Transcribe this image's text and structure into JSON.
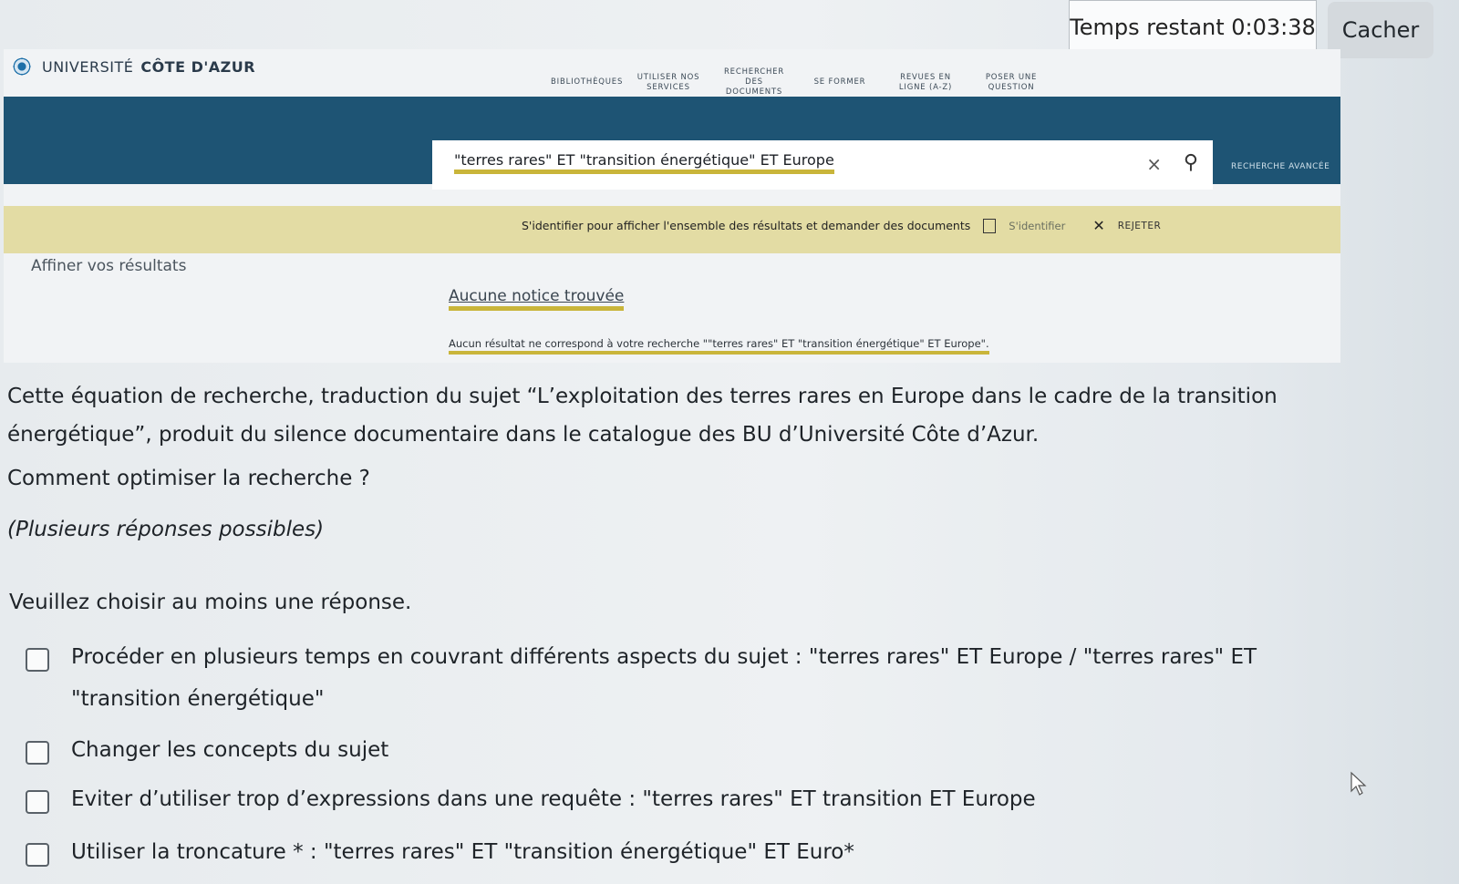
{
  "timer": {
    "label": "Temps restant 0:03:38",
    "hide_label": "Cacher"
  },
  "portal": {
    "brand_prefix": "UNIVERSITÉ",
    "brand_name": "CÔTE D'AZUR",
    "nav": [
      "BIBLIOTHÈQUES",
      "UTILISER NOS SERVICES",
      "RECHERCHER DES DOCUMENTS",
      "SE FORMER",
      "REVUES EN LIGNE (A-Z)",
      "POSER UNE QUESTION"
    ],
    "search_query": "\"terres rares\" ET \"transition énergétique\" ET Europe",
    "advanced_search": "RECHERCHE AVANCÉE",
    "login_message": "S'identifier pour afficher l'ensemble des résultats et demander des documents",
    "login_link": "S'identifier",
    "reject": "REJETER",
    "refine": "Affiner vos résultats",
    "notice_title": "Aucune notice trouvée",
    "no_result": "Aucun résultat ne correspond à votre recherche \"\"terres rares\" ET \"transition énergétique\" ET Europe\"."
  },
  "question": {
    "text": "Cette équation de recherche, traduction du sujet “L’exploitation des terres rares en Europe dans le cadre de la transition énergétique”, produit du silence documentaire dans le catalogue des BU d’Université Côte d’Azur.",
    "subquestion": "Comment optimiser la recherche ?",
    "hint": "(Plusieurs réponses possibles)",
    "requirement": "Veuillez choisir au moins une réponse.",
    "options": [
      "Procéder en plusieurs temps en couvrant différents aspects du sujet : \"terres rares\" ET Europe / \"terres rares\" ET \"transition énergétique\"",
      "Changer les concepts du sujet",
      "Eviter d’utiliser trop d’expressions dans une requête : \"terres rares\" ET transition ET Europe",
      "Utiliser la troncature * : \"terres rares\" ET \"transition énergétique\" ET Euro*"
    ]
  }
}
